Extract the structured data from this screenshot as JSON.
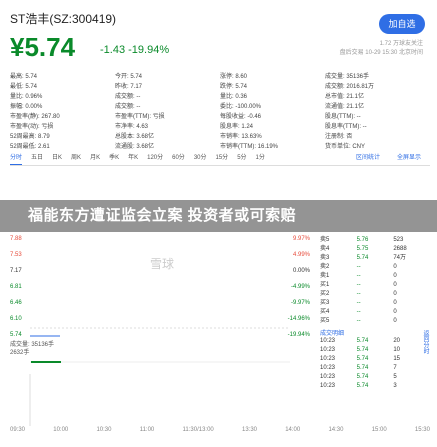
{
  "header": {
    "title": "ST浩丰(SZ:300419)",
    "add_label": "加自选",
    "price": "¥5.74",
    "change": "-1.43 -19.94%",
    "meta_line1": "1.72 万球友关注",
    "meta_line2": "盘后交易 10-29 15:30 北京时间"
  },
  "stats": [
    [
      "最高: 5.74",
      "今开: 5.74",
      "涨停: 8.60",
      "成交量: 35136手"
    ],
    [
      "最低: 5.74",
      "昨收: 7.17",
      "跌停: 5.74",
      "成交额: 2016.81万"
    ],
    [
      "量比: 0.96%",
      "成交额: --",
      "量比: 0.36",
      "总市值: 21.1亿"
    ],
    [
      "振幅: 0.00%",
      "成交额: --",
      "委比: -100.00%",
      "流通值: 21.1亿"
    ],
    [
      "市盈率(静): 267.80",
      "市盈率(TTM): 亏损",
      "每股收益: -0.46",
      "股息(TTM): --"
    ],
    [
      "市盈率(动): 亏损",
      "市净率: 4.63",
      "股息率: 1.24",
      "股息率(TTM): --"
    ],
    [
      "52周最高: 8.79",
      "总股本: 3.68亿",
      "市销率: 13.63%",
      "注册制: 否"
    ],
    [
      "52周最低: 2.61",
      "流通股: 3.68亿",
      "市销率(TTM): 16.19%",
      "货币单位: CNY"
    ]
  ],
  "tabs": [
    "分时",
    "五日",
    "日K",
    "周K",
    "月K",
    "季K",
    "年K",
    "120分",
    "60分",
    "30分",
    "15分",
    "5分",
    "1分"
  ],
  "tabs_right": [
    "区间统计",
    "全屏显示"
  ],
  "banner": "福能东方遭证监会立案 投资者或可索赔",
  "watermark": "雪球",
  "y_left": [
    "7.88",
    "7.53",
    "7.17",
    "6.81",
    "6.46",
    "6.10",
    "5.74"
  ],
  "y_right": [
    "9.97%",
    "4.99%",
    "0.00%",
    "-4.99%",
    "-9.97%",
    "-14.96%",
    "-19.94%"
  ],
  "volume_label": "成交量: 35136手",
  "volume_value": "2632手",
  "x_axis": [
    "09:30",
    "10:00",
    "10:30",
    "11:00",
    "11:30/13:00",
    "13:30",
    "14:00",
    "14:30",
    "15:00",
    "15:30"
  ],
  "order_book": {
    "asks": [
      [
        "卖5",
        "5.76",
        "523"
      ],
      [
        "卖4",
        "5.75",
        "2688"
      ],
      [
        "卖3",
        "5.74",
        "74万"
      ],
      [
        "卖2",
        "--",
        "0"
      ],
      [
        "卖1",
        "--",
        "0"
      ]
    ],
    "bids": [
      [
        "买1",
        "--",
        "0"
      ],
      [
        "买2",
        "--",
        "0"
      ],
      [
        "买3",
        "--",
        "0"
      ],
      [
        "买4",
        "--",
        "0"
      ],
      [
        "买5",
        "--",
        "0"
      ]
    ],
    "trades_title": "成交明细",
    "trades": [
      [
        "10:23",
        "5.74",
        "20"
      ],
      [
        "10:23",
        "5.74",
        "10"
      ],
      [
        "10:23",
        "5.74",
        "15"
      ],
      [
        "10:23",
        "5.74",
        "7"
      ],
      [
        "10:23",
        "5.74",
        "5"
      ],
      [
        "10:23",
        "5.74",
        "3"
      ]
    ],
    "timer": "返回分时"
  },
  "colors": {
    "down": "#0a8a2a",
    "accent": "#2f6ee5"
  }
}
